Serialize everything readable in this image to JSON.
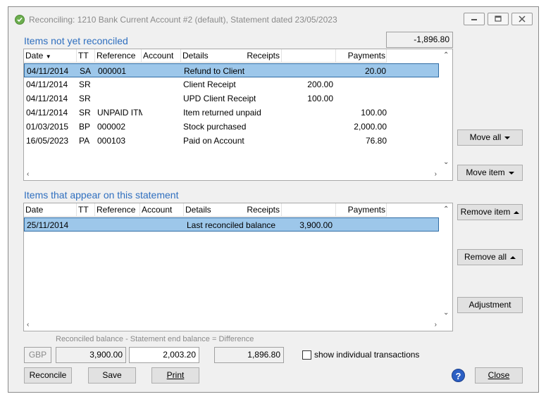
{
  "window": {
    "title": "Reconciling: 1210 Bank Current Account #2 (default), Statement dated 23/05/2023"
  },
  "unreconciled": {
    "title": "Items not yet reconciled",
    "total": "-1,896.80",
    "columns": [
      "Date",
      "TT",
      "Reference",
      "Account",
      "Details",
      "Receipts",
      "Payments"
    ],
    "rows": [
      {
        "date": "04/11/2014",
        "tt": "SA",
        "ref": "000001",
        "account": "",
        "details": "Refund to Client",
        "receipts": "",
        "payments": "20.00",
        "selected": true
      },
      {
        "date": "04/11/2014",
        "tt": "SR",
        "ref": "",
        "account": "",
        "details": "Client Receipt",
        "receipts": "200.00",
        "payments": ""
      },
      {
        "date": "04/11/2014",
        "tt": "SR",
        "ref": "",
        "account": "",
        "details": "UPD Client Receipt",
        "receipts": "100.00",
        "payments": ""
      },
      {
        "date": "04/11/2014",
        "tt": "SR",
        "ref": "UNPAID ITM",
        "account": "",
        "details": "Item returned unpaid",
        "receipts": "",
        "payments": "100.00"
      },
      {
        "date": "01/03/2015",
        "tt": "BP",
        "ref": "000002",
        "account": "",
        "details": "Stock purchased",
        "receipts": "",
        "payments": "2,000.00"
      },
      {
        "date": "16/05/2023",
        "tt": "PA",
        "ref": "000103",
        "account": "",
        "details": "Paid on Account",
        "receipts": "",
        "payments": "76.80"
      }
    ]
  },
  "statement": {
    "title": "Items that appear on this statement",
    "columns": [
      "Date",
      "TT",
      "Reference",
      "Account",
      "Details",
      "Receipts",
      "Payments"
    ],
    "rows": [
      {
        "date": "25/11/2014",
        "tt": "",
        "ref": "",
        "account": "",
        "details": "Last reconciled balance",
        "receipts": "3,900.00",
        "payments": "",
        "selected": true
      }
    ]
  },
  "side_buttons": {
    "move_all": "Move all",
    "move_item": "Move item",
    "remove_item": "Remove item",
    "remove_all": "Remove all",
    "adjustment": "Adjustment"
  },
  "footer": {
    "formula": "Reconciled balance - Statement end balance = Difference",
    "currency": "GBP",
    "reconciled_balance": "3,900.00",
    "statement_end_balance": "2,003.20",
    "difference": "1,896.80",
    "show_individual": "show individual transactions",
    "show_individual_checked": false
  },
  "bottom_buttons": {
    "reconcile": "Reconcile",
    "save": "Save",
    "print": "Print",
    "close": "Close"
  },
  "colors": {
    "accent": "#2f6fbf",
    "selection": "#9dc7ea",
    "selection_border": "#2f6ca4"
  }
}
